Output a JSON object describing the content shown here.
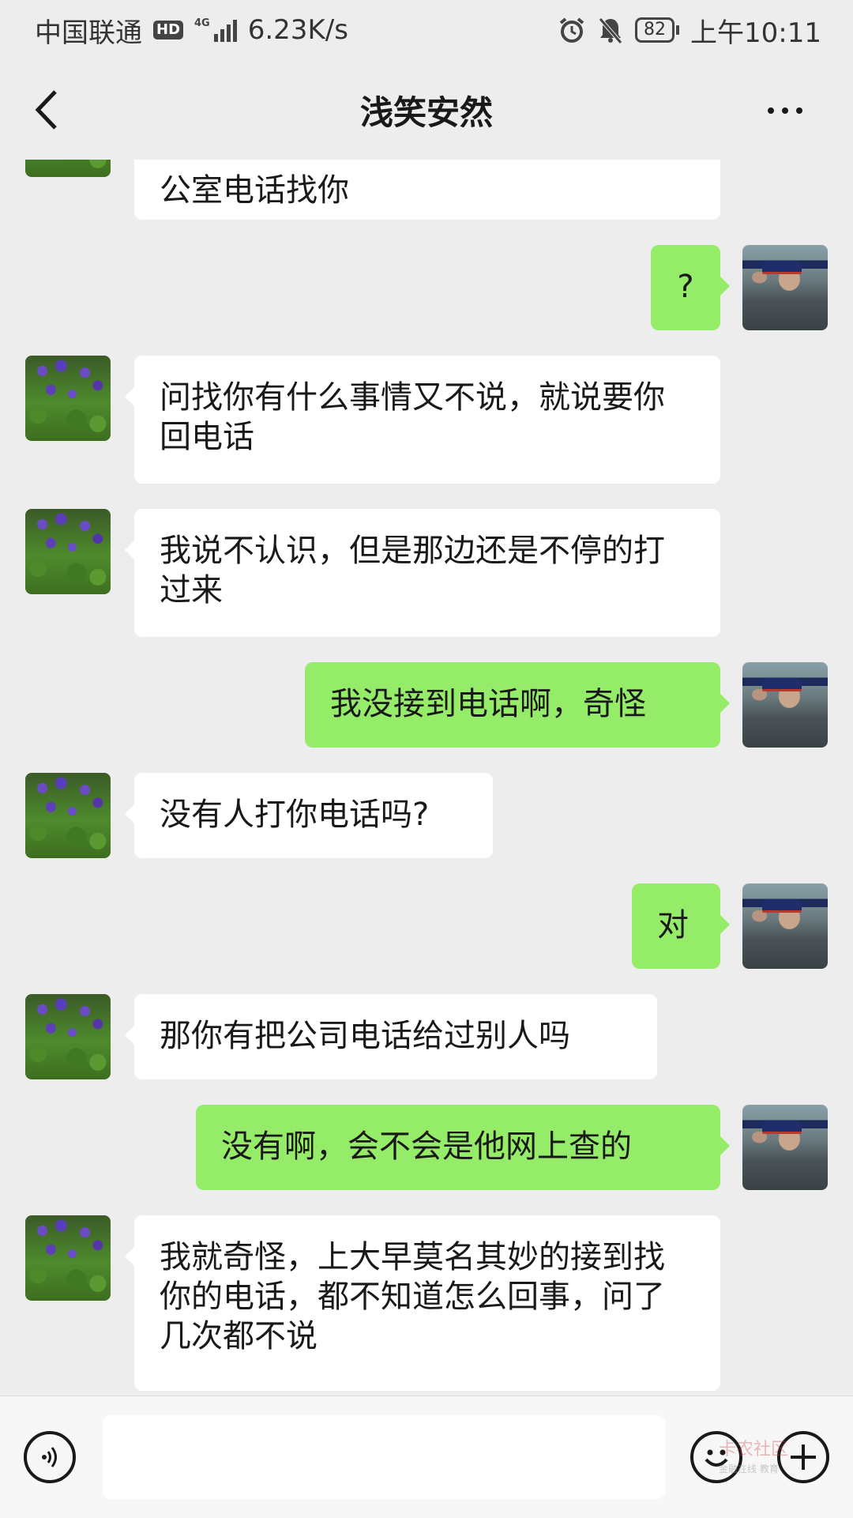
{
  "status_bar": {
    "carrier": "中国联通",
    "hd": "HD",
    "network": "4G",
    "speed": "6.23K/s",
    "battery": "82",
    "time": "上午10:11"
  },
  "title_bar": {
    "title": "浅笑安然"
  },
  "messages": [
    {
      "side": "in",
      "avatar": "flower-avatar",
      "text": "公室电话找你"
    },
    {
      "side": "out",
      "avatar": "soldier-avatar",
      "text": "?"
    },
    {
      "side": "in",
      "avatar": "flower-avatar",
      "text": "问找你有什么事情又不说，就说要你回电话"
    },
    {
      "side": "in",
      "avatar": "flower-avatar",
      "text": "我说不认识，但是那边还是不停的打过来"
    },
    {
      "side": "out",
      "avatar": "soldier-avatar",
      "text": "我没接到电话啊，奇怪"
    },
    {
      "side": "in",
      "avatar": "flower-avatar",
      "text": "没有人打你电话吗?"
    },
    {
      "side": "out",
      "avatar": "soldier-avatar",
      "text": "对"
    },
    {
      "side": "in",
      "avatar": "flower-avatar",
      "text": "那你有把公司电话给过别人吗"
    },
    {
      "side": "out",
      "avatar": "soldier-avatar",
      "text": "没有啊，会不会是他网上查的"
    },
    {
      "side": "in",
      "avatar": "flower-avatar",
      "text": "我就奇怪，上大早莫名其妙的接到找你的电话，都不知道怎么回事，问了几次都不说"
    }
  ],
  "input_bar": {
    "message_value": "",
    "watermark_top": "卡农社区",
    "watermark_bottom": "金融在线 教育"
  },
  "colors": {
    "background": "#ededed",
    "incoming_bubble": "#ffffff",
    "outgoing_bubble": "#95ec69"
  }
}
